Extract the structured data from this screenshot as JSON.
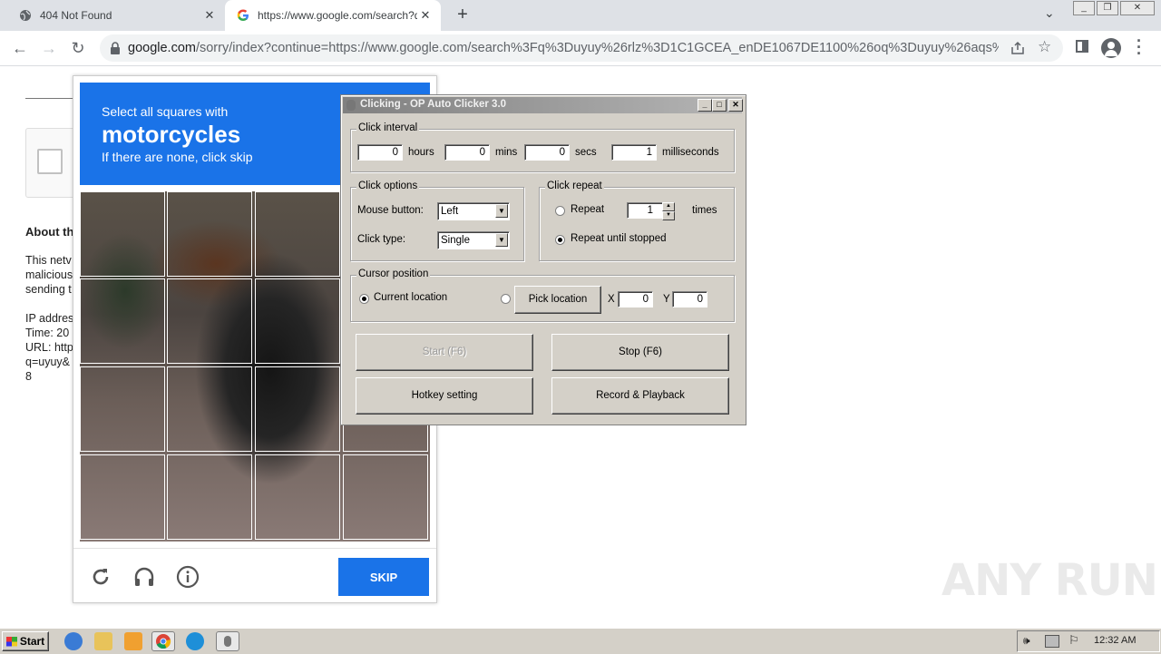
{
  "browser": {
    "tabs": [
      {
        "title": "404 Not Found",
        "active": false
      },
      {
        "title": "https://www.google.com/search?q=",
        "active": true
      }
    ],
    "address": {
      "domain": "google.com",
      "path": "/sorry/index?continue=https://www.google.com/search%3Fq%3Duyuy%26rlz%3D1C1GCEA_enDE1067DE1100%26oq%3Duyuy%26aqs%..."
    },
    "window_controls": {
      "minimize": "_",
      "restore": "❐",
      "close": "✕"
    }
  },
  "page": {
    "about_heading": "About th",
    "lines": [
      "This netv",
      "malicious",
      "sending t",
      "",
      "IP addres",
      "Time: 20",
      "URL: http",
      "q=uyuy&",
      "8"
    ]
  },
  "captcha": {
    "instruction": "Select all squares with",
    "target": "motorcycles",
    "hint": "If there are none, click skip",
    "skip_label": "SKIP",
    "colors": {
      "header": "#1a73e8",
      "button": "#1a73e8"
    }
  },
  "clicker": {
    "title": "Clicking - OP Auto Clicker 3.0",
    "interval": {
      "label": "Click interval",
      "hours": "0",
      "hours_label": "hours",
      "mins": "0",
      "mins_label": "mins",
      "secs": "0",
      "secs_label": "secs",
      "ms": "1",
      "ms_label": "milliseconds"
    },
    "options": {
      "label": "Click options",
      "mouse_button_label": "Mouse button:",
      "mouse_button": "Left",
      "click_type_label": "Click type:",
      "click_type": "Single"
    },
    "repeat": {
      "label": "Click repeat",
      "repeat_label": "Repeat",
      "repeat_count": "1",
      "times_label": "times",
      "until_stopped_label": "Repeat until stopped",
      "selected": "until_stopped"
    },
    "cursor": {
      "label": "Cursor position",
      "current_label": "Current location",
      "pick_label": "Pick location",
      "x_label": "X",
      "x": "0",
      "y_label": "Y",
      "y": "0",
      "selected": "current"
    },
    "buttons": {
      "start": "Start (F6)",
      "stop": "Stop (F6)",
      "hotkey": "Hotkey setting",
      "record": "Record & Playback"
    }
  },
  "watermark": "ANY RUN",
  "taskbar": {
    "start_label": "Start",
    "clock": "12:32 AM"
  }
}
